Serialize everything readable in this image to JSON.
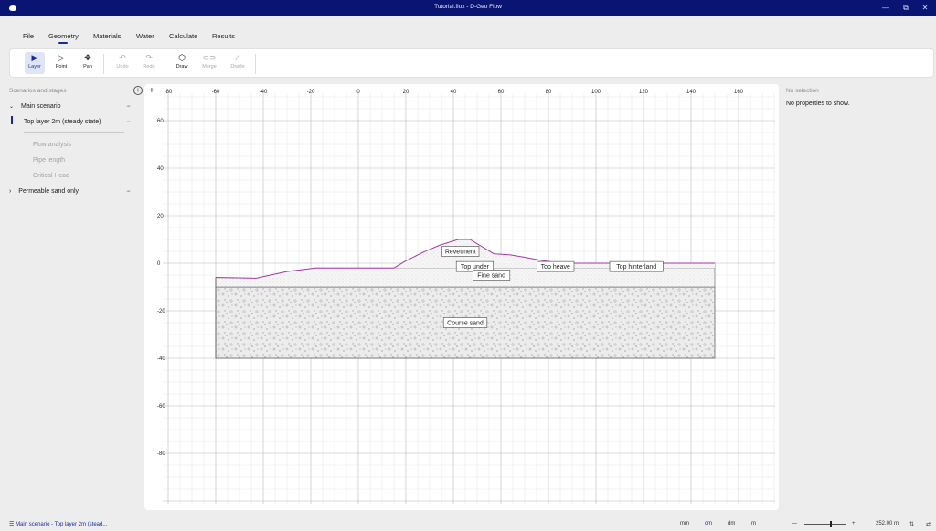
{
  "window": {
    "title": "Tutorial.flox - D-Geo Flow",
    "controls": [
      "—",
      "⧉",
      "✕"
    ]
  },
  "menu": {
    "items": [
      "File",
      "Geometry",
      "Materials",
      "Water",
      "Calculate",
      "Results"
    ],
    "active": "Geometry"
  },
  "toolbar": {
    "layer": "Layer",
    "point": "Point",
    "pan": "Pan",
    "undo": "Undo",
    "redo": "Redo",
    "draw": "Draw",
    "merge": "Merge",
    "divide": "Divide"
  },
  "sidebar": {
    "header": "Scenarios and stages",
    "main_scenario": "Main scenario",
    "stage": "Top layer 2m (steady state)",
    "flow_analysis": "Flow analysis",
    "pipe_length": "Pipe length",
    "critical_head": "Critical Head",
    "second_scenario": "Permeable sand only",
    "dots": "···"
  },
  "canvas": {
    "x_ticks": [
      "-80",
      "-60",
      "-40",
      "-20",
      "0",
      "20",
      "40",
      "60",
      "80",
      "100",
      "120",
      "140",
      "160"
    ],
    "y_ticks": [
      "60",
      "40",
      "20",
      "0",
      "-20",
      "-40",
      "-60",
      "-80"
    ],
    "plus": "+",
    "layers": {
      "revetment": "Revetment",
      "top_under": "Top under",
      "fine_sand": "Fine sand",
      "top_heave": "Top heave",
      "top_hinterland": "Top hinterland",
      "course_sand": "Course sand"
    },
    "colors": {
      "surface_line": "#a43aa6",
      "grid": "#e0e0e0",
      "major_grid": "#b8b8b8"
    }
  },
  "properties": {
    "title": "No selection",
    "message": "No properties to show."
  },
  "status": {
    "breadcrumb": "Main scenario - Top layer 2m (stead...",
    "units": [
      "mm",
      "cm",
      "dm",
      "m"
    ],
    "active_unit": "cm",
    "zoom_value": "252.00 m",
    "zoom_level": 0.6,
    "minus": "—",
    "plus": "+"
  }
}
